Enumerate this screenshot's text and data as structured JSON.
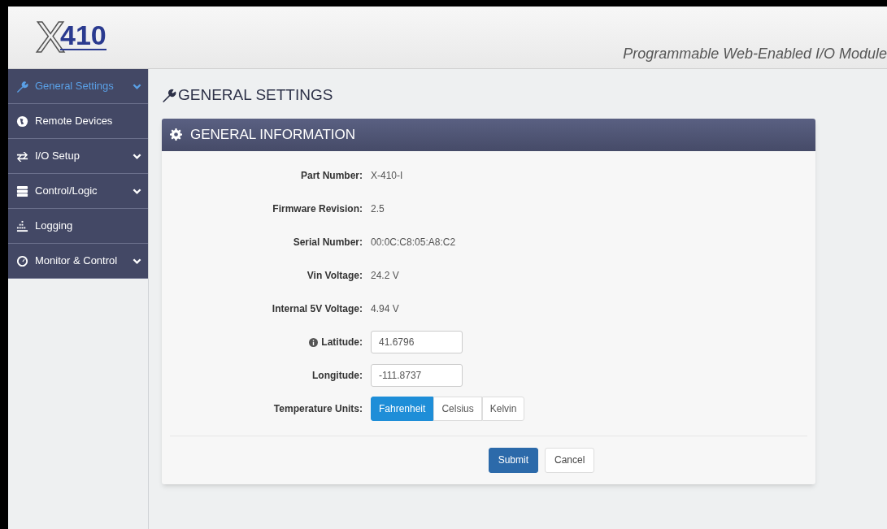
{
  "header": {
    "logo": {
      "letter": "X",
      "number": "410"
    },
    "tagline": "Programmable Web-Enabled I/O Module"
  },
  "sidebar": {
    "items": [
      {
        "label": "General Settings",
        "selected": true,
        "has_submenu": true
      },
      {
        "label": "Remote Devices",
        "selected": false,
        "has_submenu": false
      },
      {
        "label": "I/O Setup",
        "selected": false,
        "has_submenu": true
      },
      {
        "label": "Control/Logic",
        "selected": false,
        "has_submenu": true
      },
      {
        "label": "Logging",
        "selected": false,
        "has_submenu": false
      },
      {
        "label": "Monitor & Control",
        "selected": false,
        "has_submenu": true
      }
    ]
  },
  "page_title": "GENERAL SETTINGS",
  "panel": {
    "title": "GENERAL INFORMATION",
    "rows": [
      {
        "kind": "text",
        "label": "Part Number:",
        "value": "X-410-I"
      },
      {
        "kind": "text",
        "label": "Firmware Revision:",
        "value": "2.5"
      },
      {
        "kind": "text",
        "label": "Serial Number:",
        "value": "00:0C:C8:05:A8:C2"
      },
      {
        "kind": "text",
        "label": "Vin Voltage:",
        "value": "24.2 V"
      },
      {
        "kind": "text",
        "label": "Internal 5V Voltage:",
        "value": "4.94 V"
      },
      {
        "kind": "input",
        "label": "Latitude:",
        "info": true,
        "value": "41.6796"
      },
      {
        "kind": "input",
        "label": "Longitude:",
        "value": "-111.8737"
      },
      {
        "kind": "choice",
        "label": "Temperature Units:",
        "options": [
          {
            "label": "Fahrenheit",
            "selected": true
          },
          {
            "label": "Celsius",
            "selected": false
          },
          {
            "label": "Kelvin",
            "selected": false
          }
        ]
      }
    ],
    "buttons": [
      {
        "kind": "primary",
        "label": "Submit"
      },
      {
        "kind": "default",
        "label": "Cancel"
      }
    ]
  }
}
